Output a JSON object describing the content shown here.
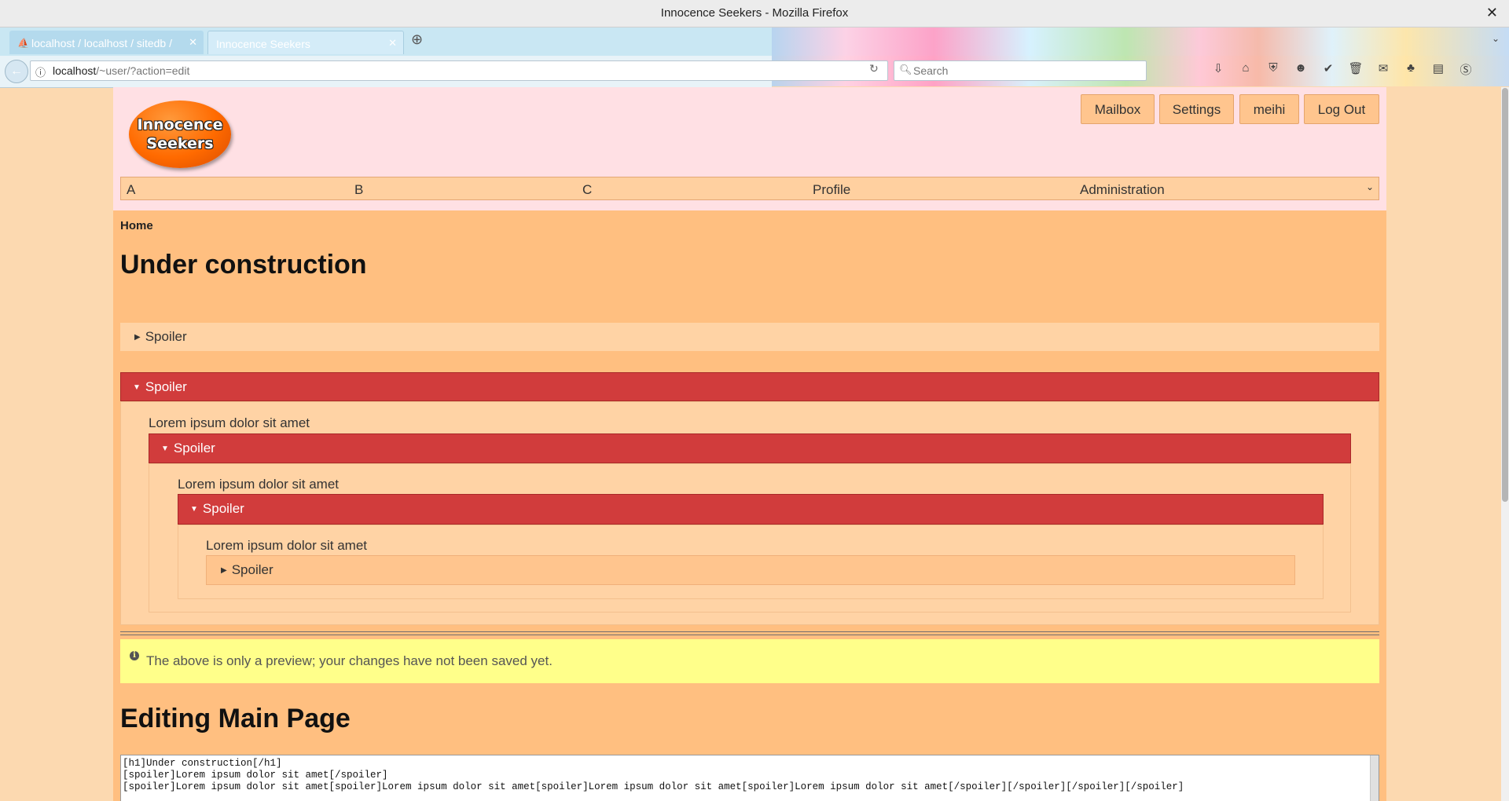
{
  "window": {
    "title": "Innocence Seekers - Mozilla Firefox",
    "close_glyph": "✕"
  },
  "tabs": [
    {
      "label": "localhost / localhost / sitedb /",
      "active": false
    },
    {
      "label": "Innocence Seekers",
      "active": true
    }
  ],
  "nav": {
    "url_host": "localhost",
    "url_path": "/~user/?action=edit",
    "search_placeholder": "Search"
  },
  "site": {
    "logo_line1": "Innocence",
    "logo_line2": "Seekers",
    "header_buttons": [
      "Mailbox",
      "Settings",
      "meihi",
      "Log Out"
    ],
    "menu": [
      "A",
      "B",
      "C",
      "Profile",
      "Administration"
    ]
  },
  "content": {
    "breadcrumb": "Home",
    "title": "Under construction",
    "spoiler_label": "Spoiler",
    "lorem": "Lorem ipsum dolor sit amet",
    "notice": "The above is only a preview; your changes have not been saved yet.",
    "editing_title": "Editing Main Page",
    "editor_lines": [
      "[h1]Under construction[/h1]",
      "[spoiler]Lorem ipsum dolor sit amet[/spoiler]",
      "[spoiler]Lorem ipsum dolor sit amet[spoiler]Lorem ipsum dolor sit amet[spoiler]Lorem ipsum dolor sit amet[spoiler]Lorem ipsum dolor sit amet[/spoiler][/spoiler][/spoiler][/spoiler]"
    ]
  },
  "colors": {
    "spoiler_open": "#d13c3c",
    "page_bg": "#fcd9b0",
    "header_bg": "#ffe0e4",
    "notice_bg": "#ffff8a"
  }
}
